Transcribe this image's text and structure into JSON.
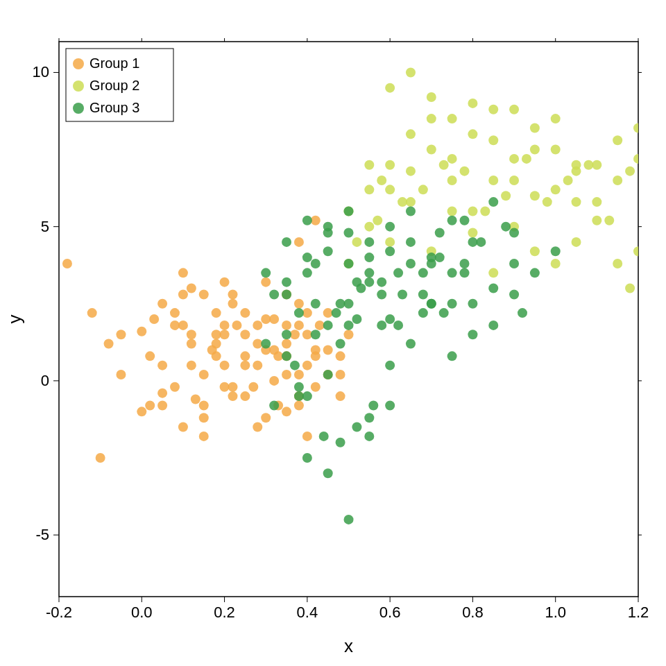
{
  "chart": {
    "title": "",
    "xAxisLabel": "x",
    "yAxisLabel": "y",
    "xMin": -0.2,
    "xMax": 1.2,
    "yMin": -7,
    "yMax": 11,
    "xTicks": [
      -0.2,
      0.0,
      0.2,
      0.4,
      0.6,
      0.8,
      1.0,
      1.2
    ],
    "yTicks": [
      -5,
      0,
      5,
      10
    ],
    "legend": [
      {
        "label": "Group 1",
        "color": "#F5A947"
      },
      {
        "label": "Group 2",
        "color": "#CCDD55"
      },
      {
        "label": "Group 3",
        "color": "#3A9E4A"
      }
    ],
    "groups": [
      {
        "name": "Group 1",
        "color": "#F5A947",
        "points": [
          [
            -0.18,
            3.8
          ],
          [
            -0.12,
            2.2
          ],
          [
            -0.05,
            1.5
          ],
          [
            0.0,
            1.6
          ],
          [
            0.02,
            0.8
          ],
          [
            0.05,
            -0.4
          ],
          [
            0.08,
            1.8
          ],
          [
            0.1,
            2.8
          ],
          [
            0.12,
            1.2
          ],
          [
            0.13,
            -0.6
          ],
          [
            0.15,
            0.2
          ],
          [
            0.17,
            1.0
          ],
          [
            0.18,
            2.2
          ],
          [
            0.2,
            1.5
          ],
          [
            0.22,
            2.8
          ],
          [
            0.23,
            1.8
          ],
          [
            0.25,
            0.5
          ],
          [
            0.27,
            -0.2
          ],
          [
            0.28,
            1.2
          ],
          [
            0.3,
            2.0
          ],
          [
            0.32,
            0.0
          ],
          [
            0.33,
            -0.8
          ],
          [
            0.35,
            0.8
          ],
          [
            0.37,
            1.5
          ],
          [
            0.38,
            2.5
          ],
          [
            0.1,
            -1.5
          ],
          [
            0.15,
            -0.8
          ],
          [
            0.2,
            3.2
          ],
          [
            0.25,
            2.2
          ],
          [
            0.3,
            -1.2
          ],
          [
            0.05,
            0.5
          ],
          [
            0.08,
            -0.2
          ],
          [
            0.12,
            3.0
          ],
          [
            0.18,
            0.8
          ],
          [
            0.22,
            -0.5
          ],
          [
            0.28,
            1.8
          ],
          [
            0.35,
            0.2
          ],
          [
            0.4,
            0.5
          ],
          [
            0.42,
            5.2
          ],
          [
            0.38,
            4.5
          ],
          [
            -0.1,
            -2.5
          ],
          [
            -0.05,
            0.2
          ],
          [
            0.0,
            -1.0
          ],
          [
            0.05,
            2.5
          ],
          [
            0.1,
            1.8
          ],
          [
            0.15,
            -1.8
          ],
          [
            0.2,
            0.5
          ],
          [
            0.25,
            -0.5
          ],
          [
            0.3,
            1.0
          ],
          [
            0.35,
            2.8
          ],
          [
            0.4,
            1.5
          ],
          [
            0.42,
            0.8
          ],
          [
            0.45,
            0.2
          ],
          [
            0.48,
            -0.5
          ],
          [
            0.38,
            -0.8
          ],
          [
            0.1,
            3.5
          ],
          [
            0.15,
            2.8
          ],
          [
            0.2,
            -0.2
          ],
          [
            0.25,
            1.5
          ],
          [
            0.3,
            3.2
          ],
          [
            0.35,
            -1.0
          ],
          [
            0.4,
            2.2
          ],
          [
            0.45,
            1.0
          ],
          [
            0.38,
            0.2
          ],
          [
            0.28,
            -1.5
          ],
          [
            -0.08,
            1.2
          ],
          [
            0.03,
            2.0
          ],
          [
            0.18,
            1.5
          ],
          [
            0.33,
            0.8
          ],
          [
            0.43,
            1.8
          ],
          [
            0.05,
            -0.8
          ],
          [
            0.2,
            1.8
          ],
          [
            0.35,
            1.2
          ],
          [
            0.48,
            0.8
          ],
          [
            0.4,
            -1.8
          ],
          [
            0.12,
            0.5
          ],
          [
            0.22,
            2.5
          ],
          [
            0.32,
            1.0
          ],
          [
            0.42,
            -0.2
          ],
          [
            0.5,
            1.5
          ],
          [
            0.15,
            -1.2
          ],
          [
            0.25,
            0.8
          ],
          [
            0.35,
            1.8
          ],
          [
            0.45,
            2.2
          ],
          [
            0.38,
            -0.5
          ],
          [
            0.08,
            2.2
          ],
          [
            0.18,
            1.2
          ],
          [
            0.28,
            0.5
          ],
          [
            0.38,
            1.8
          ],
          [
            0.48,
            0.2
          ],
          [
            0.02,
            -0.8
          ],
          [
            0.12,
            1.5
          ],
          [
            0.22,
            -0.2
          ],
          [
            0.32,
            2.0
          ],
          [
            0.42,
            1.0
          ]
        ]
      },
      {
        "name": "Group 2",
        "color": "#CCDD55",
        "points": [
          [
            0.5,
            5.5
          ],
          [
            0.55,
            6.2
          ],
          [
            0.6,
            7.0
          ],
          [
            0.65,
            6.8
          ],
          [
            0.7,
            8.5
          ],
          [
            0.75,
            7.2
          ],
          [
            0.8,
            8.0
          ],
          [
            0.85,
            6.5
          ],
          [
            0.9,
            8.8
          ],
          [
            0.95,
            7.5
          ],
          [
            1.0,
            6.2
          ],
          [
            1.05,
            5.8
          ],
          [
            1.1,
            7.0
          ],
          [
            1.15,
            7.8
          ],
          [
            1.2,
            8.2
          ],
          [
            0.6,
            9.5
          ],
          [
            0.65,
            10.0
          ],
          [
            0.7,
            9.2
          ],
          [
            0.75,
            8.5
          ],
          [
            0.8,
            9.0
          ],
          [
            0.85,
            7.8
          ],
          [
            0.9,
            6.5
          ],
          [
            0.95,
            8.2
          ],
          [
            1.0,
            7.5
          ],
          [
            1.05,
            6.8
          ],
          [
            0.55,
            7.0
          ],
          [
            0.6,
            6.2
          ],
          [
            0.65,
            8.0
          ],
          [
            0.7,
            7.5
          ],
          [
            0.75,
            6.5
          ],
          [
            0.8,
            5.5
          ],
          [
            0.85,
            8.8
          ],
          [
            0.9,
            7.2
          ],
          [
            0.95,
            6.0
          ],
          [
            1.0,
            8.5
          ],
          [
            1.05,
            7.0
          ],
          [
            1.1,
            5.8
          ],
          [
            1.15,
            6.5
          ],
          [
            1.2,
            7.2
          ],
          [
            1.18,
            3.0
          ],
          [
            0.5,
            3.8
          ],
          [
            0.55,
            5.0
          ],
          [
            0.6,
            4.5
          ],
          [
            0.65,
            5.8
          ],
          [
            0.7,
            4.2
          ],
          [
            0.75,
            5.5
          ],
          [
            0.8,
            4.8
          ],
          [
            0.85,
            3.5
          ],
          [
            0.9,
            5.0
          ],
          [
            0.95,
            4.2
          ],
          [
            1.0,
            3.8
          ],
          [
            1.05,
            4.5
          ],
          [
            1.1,
            5.2
          ],
          [
            1.15,
            3.8
          ],
          [
            1.2,
            4.2
          ],
          [
            0.58,
            6.5
          ],
          [
            0.63,
            5.8
          ],
          [
            0.68,
            6.2
          ],
          [
            0.73,
            7.0
          ],
          [
            0.78,
            6.8
          ],
          [
            0.83,
            5.5
          ],
          [
            0.88,
            6.0
          ],
          [
            0.93,
            7.2
          ],
          [
            0.98,
            5.8
          ],
          [
            1.03,
            6.5
          ],
          [
            1.08,
            7.0
          ],
          [
            1.13,
            5.2
          ],
          [
            1.18,
            6.8
          ],
          [
            0.52,
            4.5
          ],
          [
            0.57,
            5.2
          ]
        ]
      },
      {
        "name": "Group 3",
        "color": "#3A9E4A",
        "points": [
          [
            0.3,
            3.5
          ],
          [
            0.32,
            2.8
          ],
          [
            0.35,
            4.5
          ],
          [
            0.38,
            2.2
          ],
          [
            0.4,
            5.2
          ],
          [
            0.42,
            3.8
          ],
          [
            0.45,
            4.8
          ],
          [
            0.48,
            2.5
          ],
          [
            0.5,
            5.5
          ],
          [
            0.52,
            3.2
          ],
          [
            0.55,
            4.0
          ],
          [
            0.58,
            2.8
          ],
          [
            0.6,
            5.0
          ],
          [
            0.62,
            3.5
          ],
          [
            0.65,
            4.5
          ],
          [
            0.68,
            2.2
          ],
          [
            0.7,
            3.8
          ],
          [
            0.72,
            4.8
          ],
          [
            0.75,
            2.5
          ],
          [
            0.78,
            5.2
          ],
          [
            0.35,
            1.5
          ],
          [
            0.4,
            -0.5
          ],
          [
            0.45,
            0.2
          ],
          [
            0.5,
            1.8
          ],
          [
            0.55,
            -1.2
          ],
          [
            0.6,
            0.5
          ],
          [
            0.65,
            1.2
          ],
          [
            0.7,
            2.5
          ],
          [
            0.75,
            0.8
          ],
          [
            0.8,
            1.5
          ],
          [
            0.45,
            -3.0
          ],
          [
            0.5,
            -4.5
          ],
          [
            0.4,
            -2.5
          ],
          [
            0.55,
            -1.8
          ],
          [
            0.6,
            -0.8
          ],
          [
            0.35,
            0.8
          ],
          [
            0.38,
            -0.2
          ],
          [
            0.42,
            2.5
          ],
          [
            0.48,
            1.2
          ],
          [
            0.52,
            2.0
          ],
          [
            0.58,
            3.2
          ],
          [
            0.62,
            1.8
          ],
          [
            0.68,
            2.8
          ],
          [
            0.72,
            4.0
          ],
          [
            0.78,
            3.5
          ],
          [
            0.82,
            4.5
          ],
          [
            0.85,
            3.0
          ],
          [
            0.88,
            5.0
          ],
          [
            0.9,
            3.8
          ],
          [
            0.92,
            2.2
          ],
          [
            0.45,
            4.2
          ],
          [
            0.5,
            4.8
          ],
          [
            0.55,
            3.5
          ],
          [
            0.6,
            4.2
          ],
          [
            0.65,
            5.5
          ],
          [
            0.7,
            4.0
          ],
          [
            0.75,
            5.2
          ],
          [
            0.8,
            4.5
          ],
          [
            0.85,
            5.8
          ],
          [
            0.9,
            4.8
          ],
          [
            0.3,
            1.2
          ],
          [
            0.35,
            2.8
          ],
          [
            0.4,
            3.5
          ],
          [
            0.45,
            1.8
          ],
          [
            0.5,
            2.5
          ],
          [
            0.55,
            3.2
          ],
          [
            0.6,
            2.0
          ],
          [
            0.65,
            3.8
          ],
          [
            0.7,
            2.5
          ],
          [
            0.75,
            3.5
          ],
          [
            0.32,
            -0.8
          ],
          [
            0.37,
            0.5
          ],
          [
            0.42,
            1.5
          ],
          [
            0.47,
            2.2
          ],
          [
            0.53,
            3.0
          ],
          [
            0.58,
            1.8
          ],
          [
            0.63,
            2.8
          ],
          [
            0.68,
            3.5
          ],
          [
            0.73,
            2.2
          ],
          [
            0.78,
            3.8
          ],
          [
            0.48,
            -2.0
          ],
          [
            0.52,
            -1.5
          ],
          [
            0.56,
            -0.8
          ],
          [
            0.44,
            -1.8
          ],
          [
            0.38,
            -0.5
          ],
          [
            0.8,
            2.5
          ],
          [
            0.85,
            1.8
          ],
          [
            0.9,
            2.8
          ],
          [
            0.95,
            3.5
          ],
          [
            1.0,
            4.2
          ],
          [
            0.35,
            3.2
          ],
          [
            0.4,
            4.0
          ],
          [
            0.45,
            5.0
          ],
          [
            0.5,
            3.8
          ],
          [
            0.55,
            4.5
          ]
        ]
      }
    ]
  }
}
